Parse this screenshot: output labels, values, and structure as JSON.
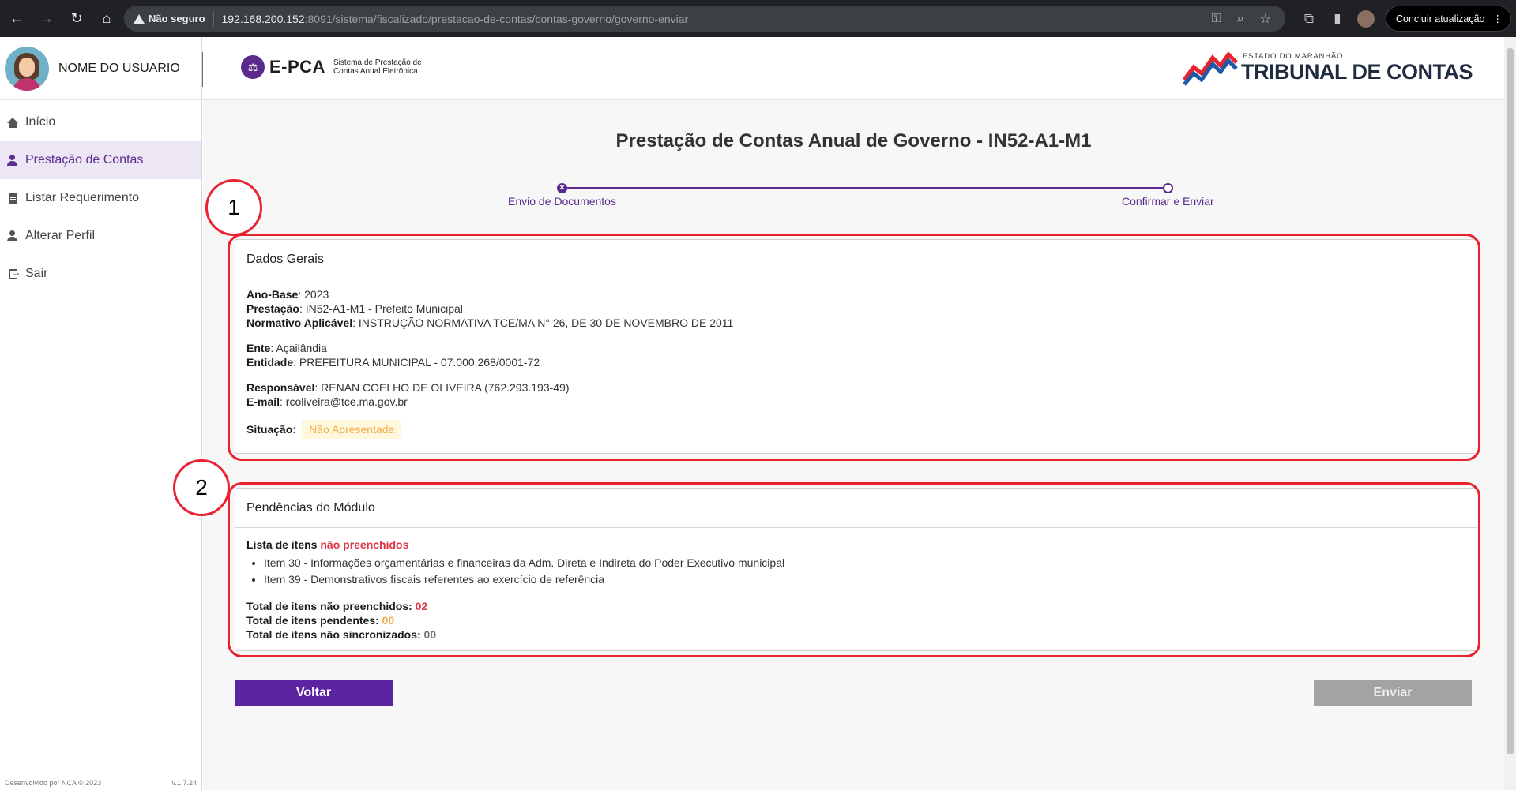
{
  "browser": {
    "not_secure": "Não seguro",
    "url_host": "192.168.200.152",
    "url_rest": ":8091/sistema/fiscalizado/prestacao-de-contas/contas-governo/governo-enviar",
    "update_label": "Concluir atualização"
  },
  "sidebar": {
    "user_name": "NOME DO USUARIO",
    "items": [
      {
        "label": "Início",
        "icon": "home-icon"
      },
      {
        "label": "Prestação de Contas",
        "icon": "user-check-icon",
        "active": true
      },
      {
        "label": "Listar Requerimento",
        "icon": "document-icon"
      },
      {
        "label": "Alterar Perfil",
        "icon": "user-edit-icon"
      },
      {
        "label": "Sair",
        "icon": "exit-icon"
      }
    ],
    "footer_left": "Desenvolvido por NCA © 2023",
    "footer_right": "v.1.7.24"
  },
  "header": {
    "logo_text": "E-PCA",
    "logo_sub_1": "Sistema de Prestação de",
    "logo_sub_2": "Contas Anual Eletrônica",
    "tce_small": "ESTADO DO MARANHÃO",
    "tce_big": "TRIBUNAL DE CONTAS"
  },
  "page": {
    "title": "Prestação de Contas Anual de Governo - IN52-A1-M1",
    "steps": [
      "Envio de Documentos",
      "Confirmar e Enviar"
    ]
  },
  "dados_gerais": {
    "header": "Dados Gerais",
    "ano_base_label": "Ano-Base",
    "ano_base": ": 2023",
    "prestacao_label": "Prestação",
    "prestacao": ": IN52-A1-M1 - Prefeito Municipal",
    "normativo_label": "Normativo Aplicável",
    "normativo": ": INSTRUÇÃO NORMATIVA TCE/MA N° 26, DE 30 DE NOVEMBRO DE 2011",
    "ente_label": "Ente",
    "ente": ": Açailândia",
    "entidade_label": "Entidade",
    "entidade": ": PREFEITURA MUNICIPAL - 07.000.268/0001-72",
    "responsavel_label": "Responsável",
    "responsavel": ": RENAN COELHO DE OLIVEIRA (762.293.193-49)",
    "email_label": "E-mail",
    "email": ": rcoliveira@tce.ma.gov.br",
    "situacao_label": "Situação",
    "situacao_sep": ":",
    "situacao": "Não Apresentada"
  },
  "pendencias": {
    "header": "Pendências do Módulo",
    "lista_prefix": "Lista de itens ",
    "lista_highlight": "não preenchidos",
    "items": [
      "Item 30 - Informações orçamentárias e financeiras da Adm. Direta e Indireta do Poder Executivo municipal",
      "Item 39 - Demonstrativos fiscais referentes ao exercício de referência"
    ],
    "total_nao_preenchidos_label": "Total de itens não preenchidos: ",
    "total_nao_preenchidos": "02",
    "total_pendentes_label": "Total de itens pendentes: ",
    "total_pendentes": "00",
    "total_nao_sincronizados_label": "Total de itens não sincronizados: ",
    "total_nao_sincronizados": "00"
  },
  "annotations": [
    "1",
    "2"
  ],
  "buttons": {
    "voltar": "Voltar",
    "enviar": "Enviar"
  },
  "colors": {
    "brand_purple": "#5b24a1",
    "annotation_red": "#e8232f",
    "warning": "#f0ad4e",
    "danger": "#dc3545"
  }
}
